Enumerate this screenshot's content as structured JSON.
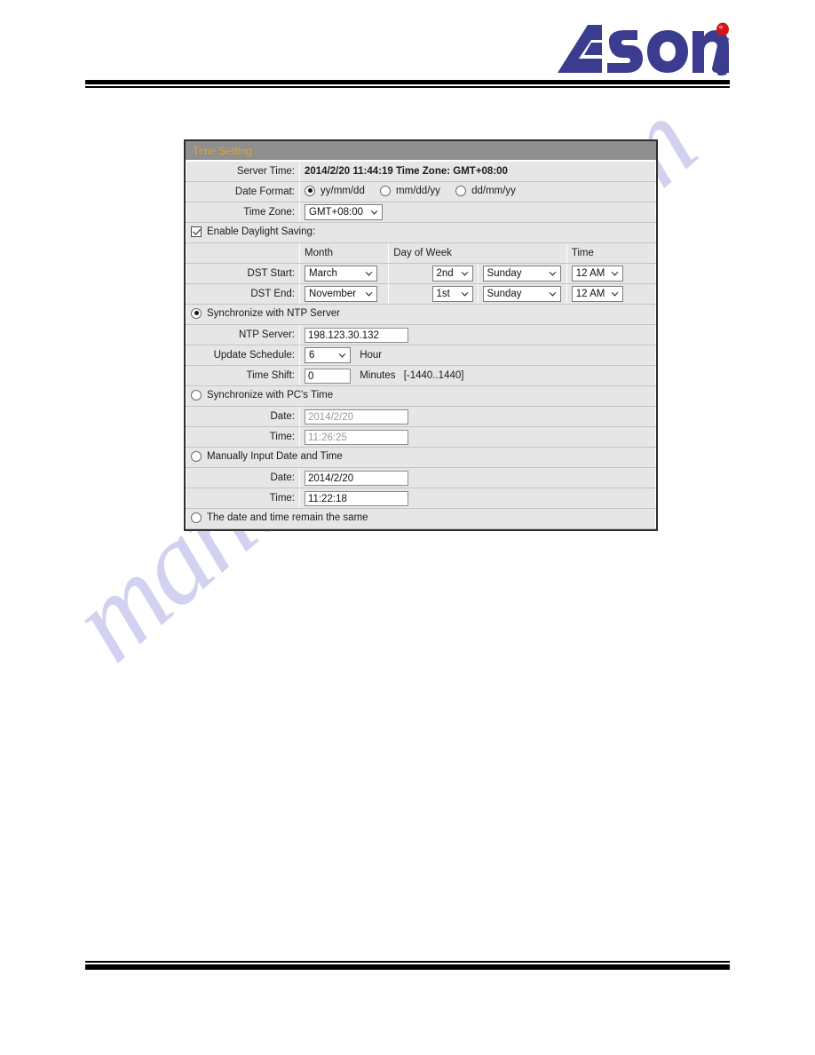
{
  "brand": {
    "name": "Asoni",
    "logo_colors": {
      "wordmark": "#3b3b8f",
      "dot": "#d31515"
    }
  },
  "watermark": {
    "text": "manualshive.com",
    "color": "#b9b6e8"
  },
  "panel": {
    "title": "Time Setting",
    "title_bg": "#8f8f8f",
    "title_color": "#e8a93c",
    "rows": {
      "server_time": {
        "label": "Server Time:",
        "value": "2014/2/20 11:44:19 Time Zone: GMT+08:00"
      },
      "date_format": {
        "label": "Date Format:",
        "options": [
          {
            "label": "yy/mm/dd",
            "selected": true
          },
          {
            "label": "mm/dd/yy",
            "selected": false
          },
          {
            "label": "dd/mm/yy",
            "selected": false
          }
        ]
      },
      "time_zone": {
        "label": "Time Zone:",
        "value": "GMT+08:00"
      },
      "enable_dst": {
        "label": "Enable Daylight Saving:",
        "checked": true
      },
      "dst_headers": {
        "blank": "",
        "month": "Month",
        "day_of_week": "Day of Week",
        "time": "Time"
      },
      "dst_start": {
        "label": "DST Start:",
        "month": "March",
        "ordinal": "2nd",
        "weekday": "Sunday",
        "time": "12 AM"
      },
      "dst_end": {
        "label": "DST End:",
        "month": "November",
        "ordinal": "1st",
        "weekday": "Sunday",
        "time": "12 AM"
      },
      "sync_ntp": {
        "label": "Synchronize with NTP Server",
        "selected": true
      },
      "ntp_server": {
        "label": "NTP Server:",
        "value": "198.123.30.132"
      },
      "update_schedule": {
        "label": "Update Schedule:",
        "value": "6",
        "unit": "Hour"
      },
      "time_shift": {
        "label": "Time Shift:",
        "value": "0",
        "unit": "Minutes",
        "range": "[-1440..1440]"
      },
      "sync_pc": {
        "label": "Synchronize with PC's Time",
        "selected": false
      },
      "pc_date": {
        "label": "Date:",
        "value": "2014/2/20"
      },
      "pc_time": {
        "label": "Time:",
        "value": "11:26:25"
      },
      "manual_input": {
        "label": "Manually Input Date and Time",
        "selected": false
      },
      "manual_date": {
        "label": "Date:",
        "value": "2014/2/20"
      },
      "manual_time": {
        "label": "Time:",
        "value": "11:22:18"
      },
      "keep_same": {
        "label": "The date and time remain the same",
        "selected": false
      }
    }
  }
}
